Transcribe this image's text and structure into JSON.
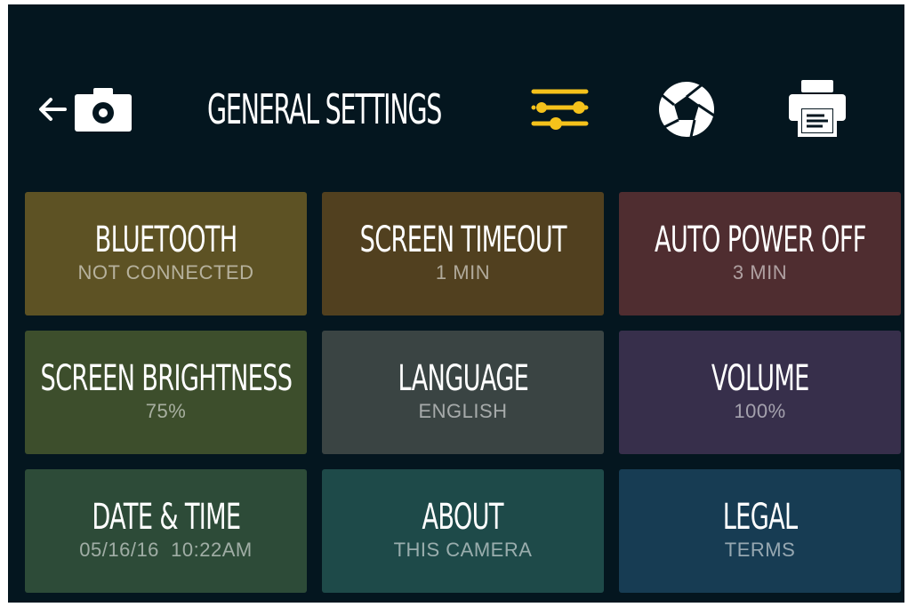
{
  "header": {
    "title": "GENERAL SETTINGS",
    "back_icon": "back-arrow-icon",
    "camera_icon": "camera-icon",
    "settings_icon": "sliders-icon",
    "shutter_icon": "aperture-icon",
    "printer_icon": "printer-icon",
    "accent_color": "#f5c21b"
  },
  "tiles": [
    {
      "label": "BLUETOOTH",
      "value": "NOT CONNECTED",
      "color": "#5d5224"
    },
    {
      "label": "SCREEN TIMEOUT",
      "value": "1 MIN",
      "color": "#51401f"
    },
    {
      "label": "AUTO POWER OFF",
      "value": "3 MIN",
      "color": "#4f2d30"
    },
    {
      "label": "SCREEN BRIGHTNESS",
      "value": "75%",
      "color": "#3d4e2c"
    },
    {
      "label": "LANGUAGE",
      "value": "ENGLISH",
      "color": "#3a4443"
    },
    {
      "label": "VOLUME",
      "value": "100%",
      "color": "#372f4b"
    },
    {
      "label": "DATE & TIME",
      "value": "05/16/16  10:22AM",
      "color": "#2d4b38"
    },
    {
      "label": "ABOUT",
      "value": "THIS CAMERA",
      "color": "#1e4a49"
    },
    {
      "label": "LEGAL",
      "value": "TERMS",
      "color": "#173c53"
    }
  ]
}
